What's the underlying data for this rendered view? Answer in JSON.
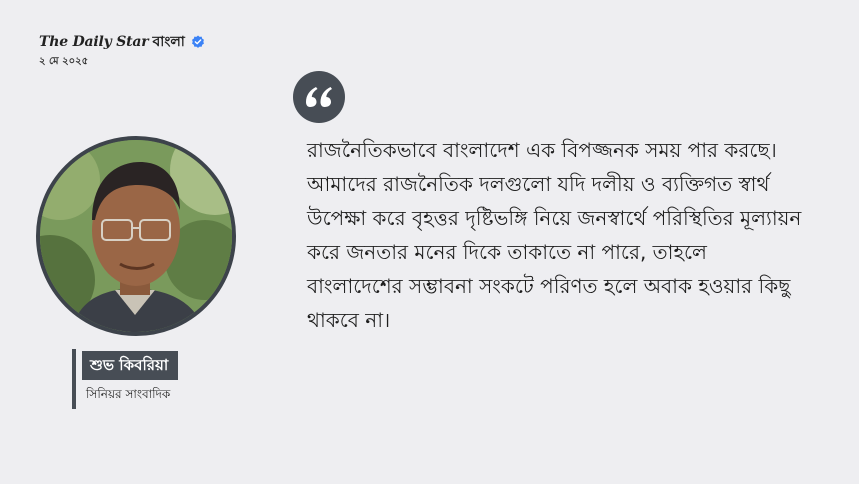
{
  "brand": {
    "logo_text": "The Daily Star",
    "bangla_text": "বাংলা",
    "verified_icon": "verified-badge-icon",
    "verified_color": "#3b82f6"
  },
  "date": "২ মে ২০২৫",
  "quote_icon": "quote-mark-icon",
  "quote": "রাজনৈতিকভাবে বাংলাদেশ এক বিপজ্জনক সময় পার করছে। আমাদের রাজনৈতিক দলগুলো যদি দলীয় ও ব্যক্তিগত স্বার্থ উপেক্ষা করে বৃহত্তর দৃষ্টিভঙ্গি নিয়ে জনস্বার্থে পরিস্থিতির মূল্যায়ন করে জনতার মনের দিকে তাকাতে না পারে, তাহলে বাংলাদেশের সম্ভাবনা সংকটে পরিণত হলে অবাক হওয়ার কিছু থাকবে না।",
  "person": {
    "name": "শুভ কিবরিয়া",
    "role": "সিনিয়র সাংবাদিক"
  },
  "colors": {
    "background": "#eeeef1",
    "accent": "#474d55",
    "text": "#1d1d1d"
  }
}
